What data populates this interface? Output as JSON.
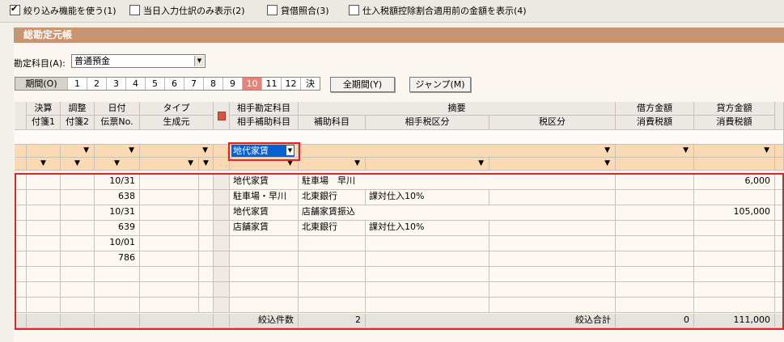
{
  "options": [
    {
      "label": "絞り込み機能を使う(1)",
      "checked": true
    },
    {
      "label": "当日入力仕訳のみ表示(2)",
      "checked": false
    },
    {
      "label": "貸借照合(3)",
      "checked": false
    },
    {
      "label": "仕入税額控除割合適用前の金額を表示(4)",
      "checked": false
    }
  ],
  "window_title": "総勘定元帳",
  "account": {
    "label": "勘定科目(A):",
    "value": "普通預金"
  },
  "period": {
    "label": "期間(O)",
    "months": [
      "1",
      "2",
      "3",
      "4",
      "5",
      "6",
      "7",
      "8",
      "9",
      "10",
      "11",
      "12",
      "決"
    ],
    "selected": "10"
  },
  "buttons": {
    "all_period": "全期間(Y)",
    "jump": "ジャンプ(M)"
  },
  "headers": {
    "row1": [
      "決算",
      "調整",
      "日付",
      "タイプ",
      "相手勘定科目",
      "摘要",
      "借方金額",
      "貸方金額"
    ],
    "row2": [
      "付箋1",
      "付箋2",
      "伝票No.",
      "生成元",
      "相手補助科目",
      "補助科目",
      "相手税区分",
      "税区分",
      "消費税額",
      "消費税額"
    ]
  },
  "filter": {
    "account_value": "地代家賃"
  },
  "rows": [
    {
      "date": "10/31",
      "account": "地代家賃",
      "memo": "駐車場　早川",
      "credit": "6,000"
    },
    {
      "voucher": "638",
      "sub_account": "駐車場・早川",
      "aux": "北東銀行",
      "tax": "課対仕入10%"
    },
    {
      "date": "10/31",
      "account": "地代家賃",
      "memo": "店舗家賃振込",
      "credit": "105,000"
    },
    {
      "voucher": "639",
      "sub_account": "店舗家賃",
      "aux": "北東銀行",
      "tax": "課対仕入10%"
    },
    {
      "date": "10/01"
    },
    {
      "voucher": "786"
    }
  ],
  "summary": {
    "count_label": "絞込件数",
    "count": "2",
    "total_label": "絞込合計",
    "debit_total": "0",
    "credit_total": "111,000"
  }
}
